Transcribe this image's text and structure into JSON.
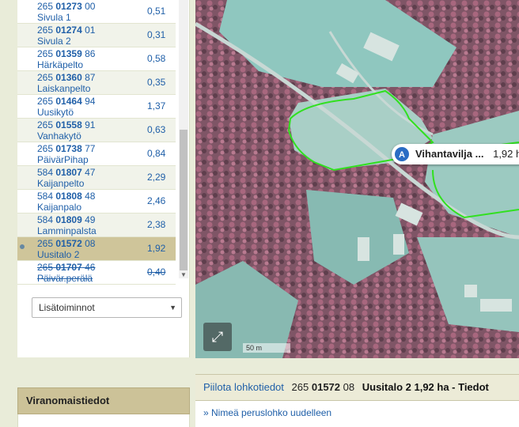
{
  "parcels": [
    {
      "prefix": "265",
      "mid": "01273",
      "suffix": "00",
      "name": "Sivula 1",
      "area": "0,51",
      "state": "normal"
    },
    {
      "prefix": "265",
      "mid": "01274",
      "suffix": "01",
      "name": "Sivula 2",
      "area": "0,31",
      "state": "alt"
    },
    {
      "prefix": "265",
      "mid": "01359",
      "suffix": "86",
      "name": "Härkäpelto",
      "area": "0,58",
      "state": "normal"
    },
    {
      "prefix": "265",
      "mid": "01360",
      "suffix": "87",
      "name": "Laiskanpelto",
      "area": "0,35",
      "state": "alt"
    },
    {
      "prefix": "265",
      "mid": "01464",
      "suffix": "94",
      "name": "Uusikytö",
      "area": "1,37",
      "state": "normal"
    },
    {
      "prefix": "265",
      "mid": "01558",
      "suffix": "91",
      "name": "Vanhakytö",
      "area": "0,63",
      "state": "alt"
    },
    {
      "prefix": "265",
      "mid": "01738",
      "suffix": "77",
      "name": "PäivärPihap",
      "area": "0,84",
      "state": "normal"
    },
    {
      "prefix": "584",
      "mid": "01807",
      "suffix": "47",
      "name": "Kaijanpelto",
      "area": "2,29",
      "state": "alt"
    },
    {
      "prefix": "584",
      "mid": "01808",
      "suffix": "48",
      "name": "Kaijanpalo",
      "area": "2,46",
      "state": "normal"
    },
    {
      "prefix": "584",
      "mid": "01809",
      "suffix": "49",
      "name": "Lamminpalsta",
      "area": "2,38",
      "state": "alt"
    },
    {
      "prefix": "265",
      "mid": "01572",
      "suffix": "08",
      "name": "Uusitalo 2",
      "area": "1,92",
      "state": "selected"
    },
    {
      "prefix": "265",
      "mid": "01707",
      "suffix": "46",
      "name": "Päivär.perälä",
      "area": "0,40",
      "state": "struck"
    }
  ],
  "extra_actions": {
    "label": "Lisätoiminnot"
  },
  "authority": {
    "title": "Viranomaistiedot"
  },
  "map": {
    "label_badge": "A",
    "label_name": "Vihantavilja ...",
    "label_area": "1,92 h",
    "fullscreen_icon": "expand-icon",
    "scale_text": "50 m"
  },
  "details": {
    "hide_link": "Piilota lohkotiedot",
    "code_prefix": "265",
    "code_mid": "01572",
    "code_suffix": "08",
    "title": "Uusitalo 2 1,92 ha - Tiedot",
    "rename_link": "» Nimeä peruslohko uudelleen"
  },
  "colors": {
    "link": "#1f5fa8",
    "selected_row": "#cfc59a",
    "header_bg": "#ccc298",
    "parcel_border": "#31e01f"
  }
}
